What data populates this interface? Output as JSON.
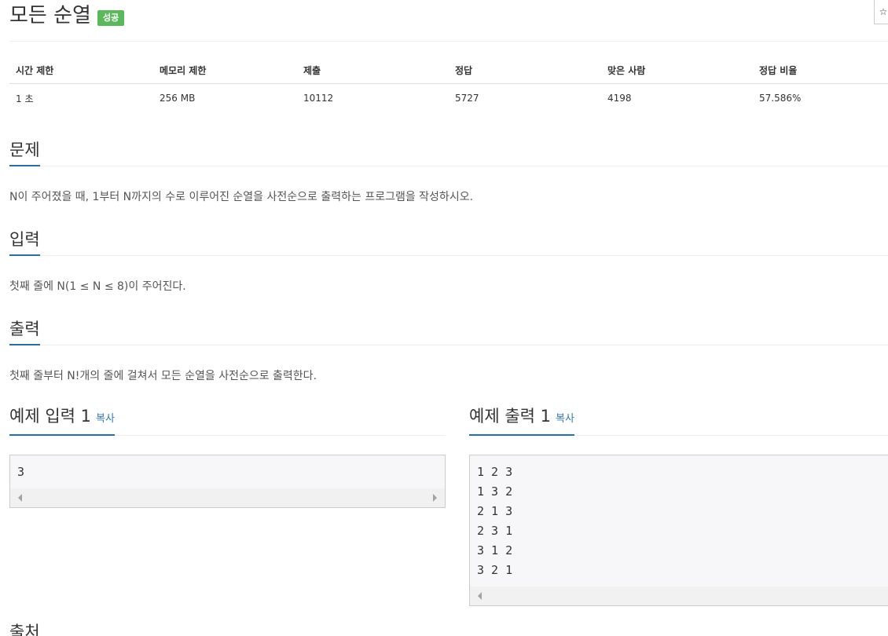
{
  "problem": {
    "title": "모든 순열",
    "badge": "성공",
    "star_icon": "☆"
  },
  "info_table": {
    "headers": [
      "시간 제한",
      "메모리 제한",
      "제출",
      "정답",
      "맞은 사람",
      "정답 비율"
    ],
    "values": [
      "1 초",
      "256 MB",
      "10112",
      "5727",
      "4198",
      "57.586%"
    ]
  },
  "sections": {
    "description": {
      "title": "문제",
      "body": "N이 주어졌을 때, 1부터 N까지의 수로 이루어진 순열을 사전순으로 출력하는 프로그램을 작성하시오."
    },
    "input": {
      "title": "입력",
      "body": "첫째 줄에 N(1 ≤ N ≤ 8)이 주어진다."
    },
    "output": {
      "title": "출력",
      "body": "첫째 줄부터 N!개의 줄에 걸쳐서 모든 순열을 사전순으로 출력한다."
    },
    "source": {
      "title": "출처"
    }
  },
  "examples": {
    "input": {
      "title": "예제 입력 1",
      "copy_label": "복사",
      "lines": [
        "3"
      ]
    },
    "output": {
      "title": "예제 출력 1",
      "copy_label": "복사",
      "lines": [
        "1 2 3",
        "1 3 2",
        "2 1 3",
        "2 3 1",
        "3 1 2",
        "3 2 1"
      ]
    }
  },
  "colors": {
    "badge_success": "#5cb85c",
    "section_underline": "#2a6fa1",
    "link": "#337ab7"
  }
}
